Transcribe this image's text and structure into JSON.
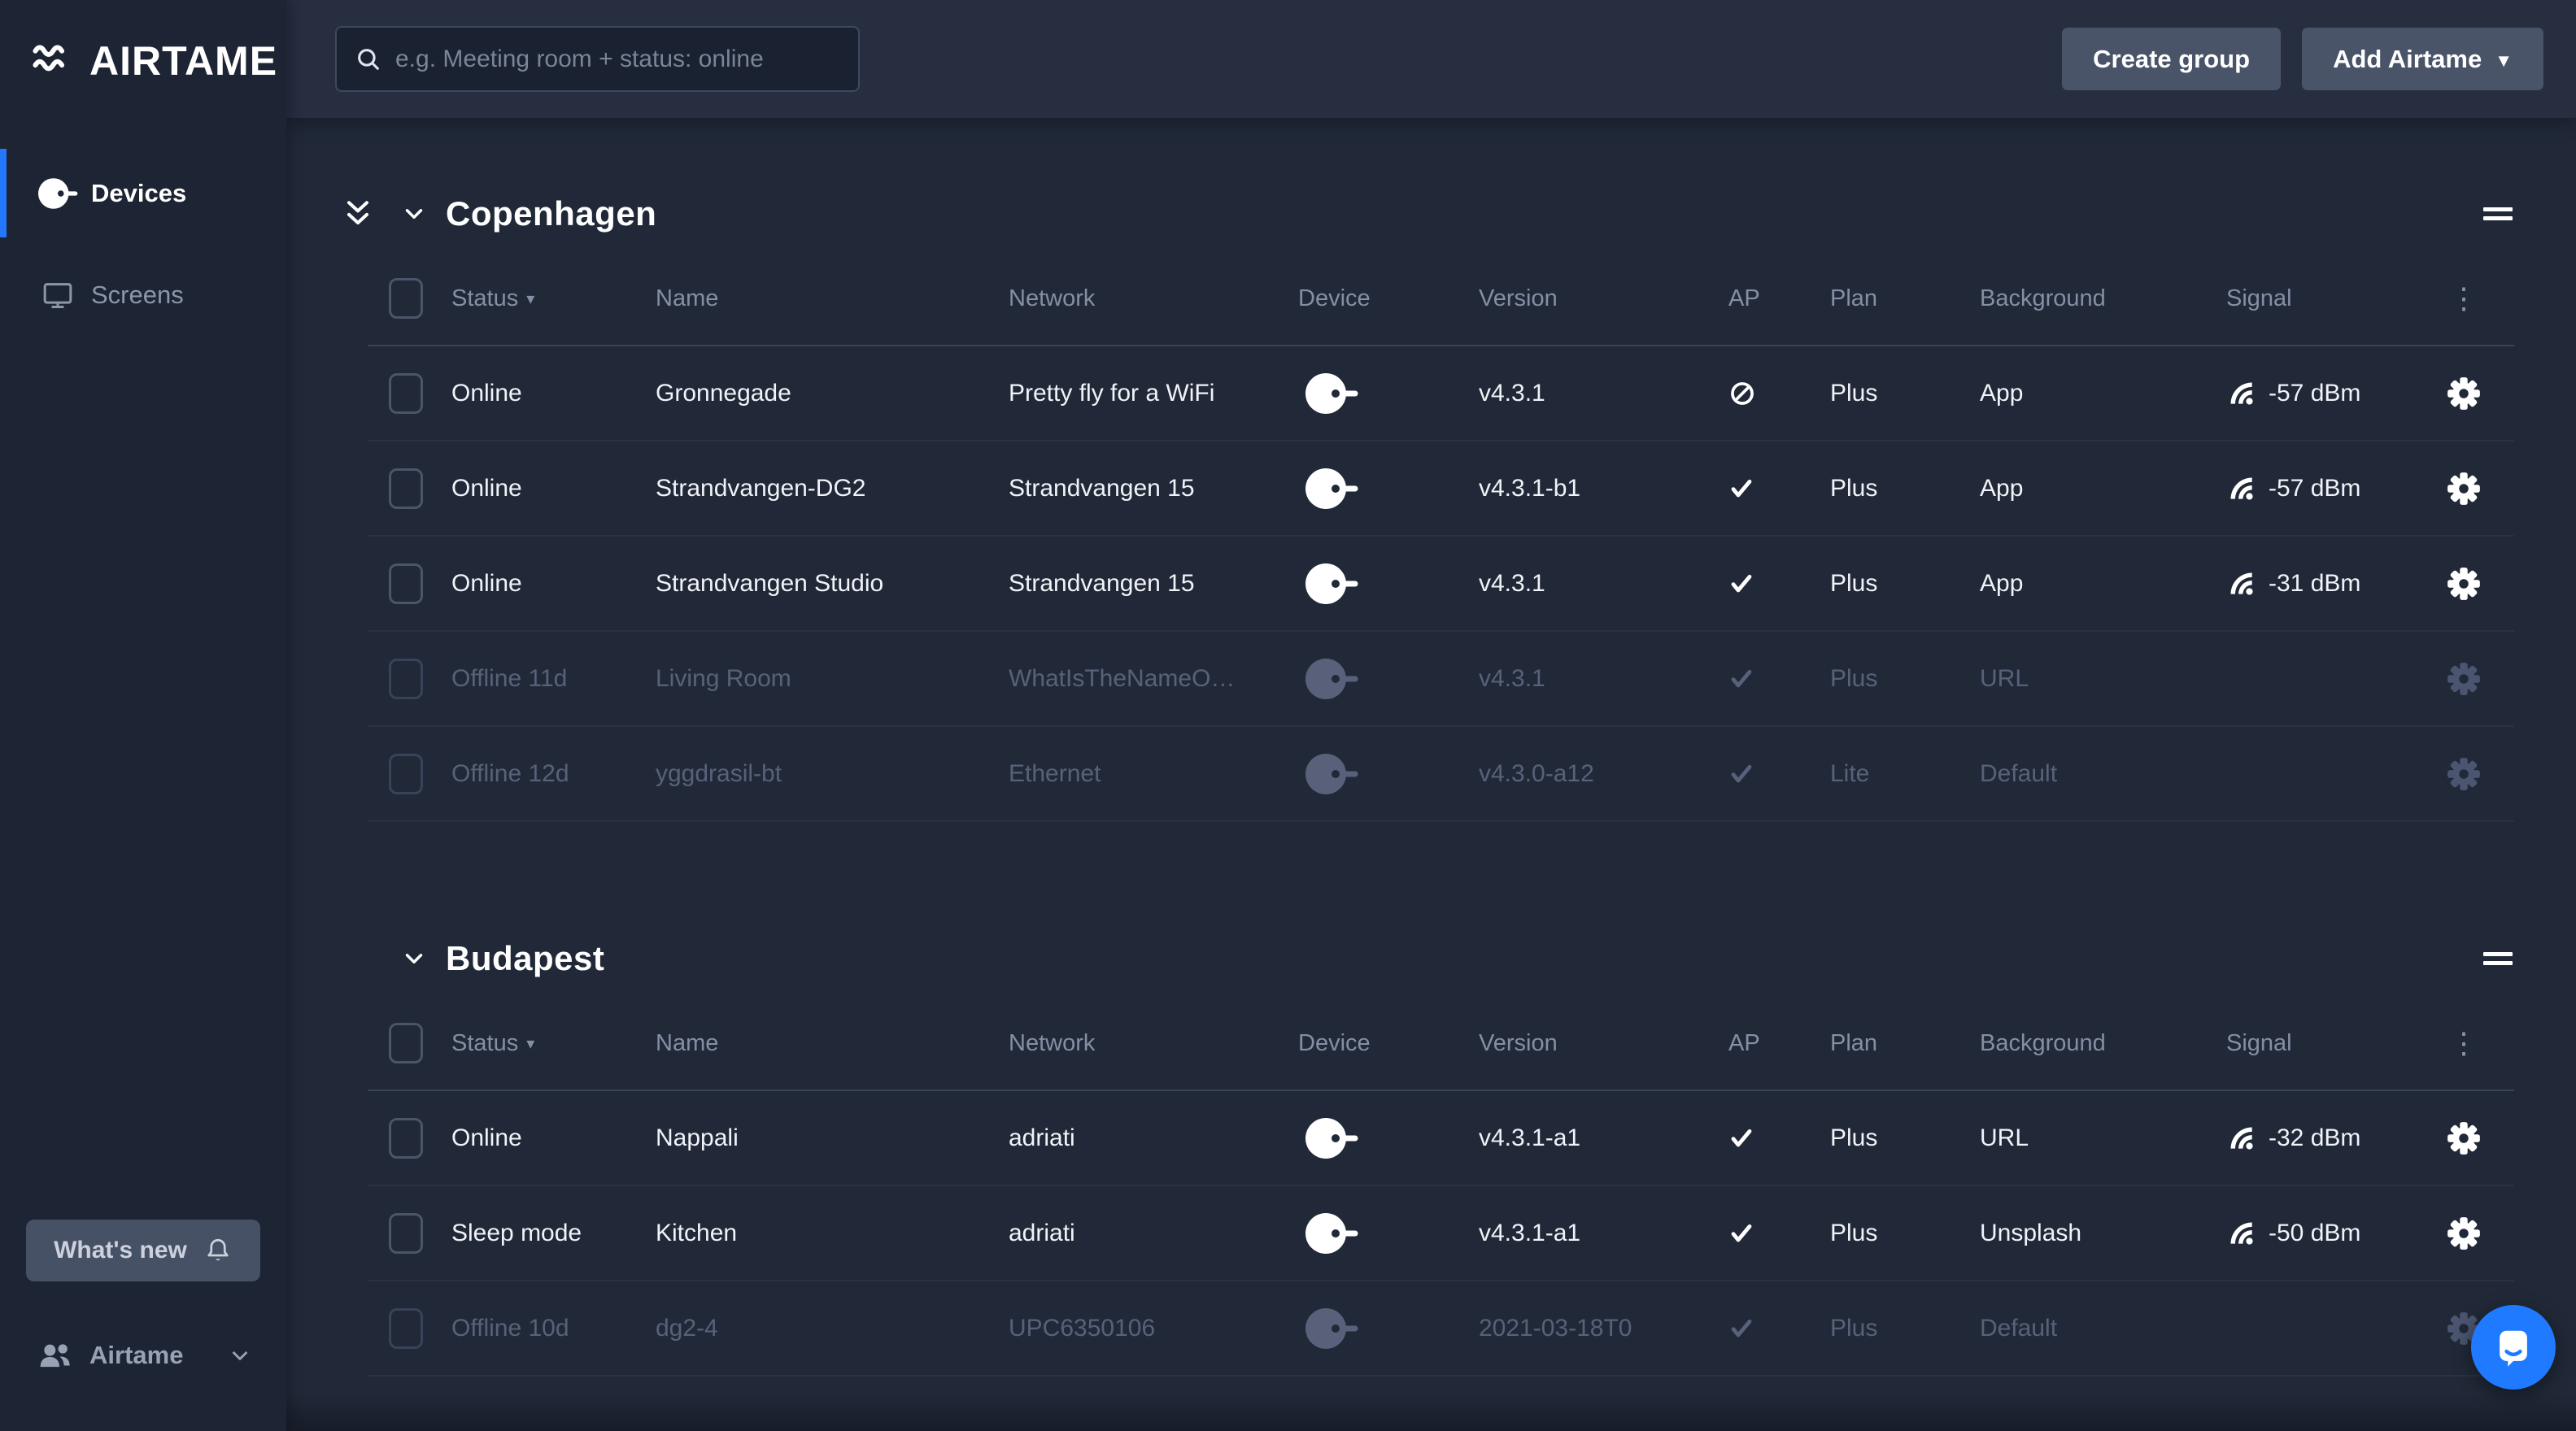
{
  "sidebar": {
    "logo_text": "AIRTAME",
    "nav": [
      {
        "label": "Devices",
        "active": true
      },
      {
        "label": "Screens",
        "active": false
      }
    ],
    "whats_new_label": "What's new",
    "org_label": "Airtame"
  },
  "topbar": {
    "search_placeholder": "e.g. Meeting room + status: online",
    "create_group_label": "Create group",
    "add_airtame_label": "Add Airtame"
  },
  "table": {
    "columns": [
      "Status",
      "Name",
      "Network",
      "Device",
      "Version",
      "AP",
      "Plan",
      "Background",
      "Signal"
    ]
  },
  "groups": [
    {
      "name": "Copenhagen",
      "collapse_all": true,
      "rows": [
        {
          "status": "Online",
          "name": "Gronnegade",
          "network": "Pretty fly for a WiFi",
          "version": "v4.3.1",
          "ap": "blocked",
          "plan": "Plus",
          "background": "App",
          "signal": "-57 dBm",
          "offline": false
        },
        {
          "status": "Online",
          "name": "Strandvangen-DG2",
          "network": "Strandvangen 15",
          "version": "v4.3.1-b1",
          "ap": "check",
          "plan": "Plus",
          "background": "App",
          "signal": "-57 dBm",
          "offline": false
        },
        {
          "status": "Online",
          "name": "Strandvangen Studio",
          "network": "Strandvangen 15",
          "version": "v4.3.1",
          "ap": "check",
          "plan": "Plus",
          "background": "App",
          "signal": "-31 dBm",
          "offline": false
        },
        {
          "status": "Offline 11d",
          "name": "Living Room",
          "network": "WhatIsTheNameO…",
          "version": "v4.3.1",
          "ap": "check",
          "plan": "Plus",
          "background": "URL",
          "signal": "",
          "offline": true
        },
        {
          "status": "Offline 12d",
          "name": "yggdrasil-bt",
          "network": "Ethernet",
          "version": "v4.3.0-a12",
          "ap": "check",
          "plan": "Lite",
          "background": "Default",
          "signal": "",
          "offline": true
        }
      ]
    },
    {
      "name": "Budapest",
      "collapse_all": false,
      "rows": [
        {
          "status": "Online",
          "name": "Nappali",
          "network": "adriati",
          "version": "v4.3.1-a1",
          "ap": "check",
          "plan": "Plus",
          "background": "URL",
          "signal": "-32 dBm",
          "offline": false
        },
        {
          "status": "Sleep mode",
          "name": "Kitchen",
          "network": "adriati",
          "version": "v4.3.1-a1",
          "ap": "check",
          "plan": "Plus",
          "background": "Unsplash",
          "signal": "-50 dBm",
          "offline": false
        },
        {
          "status": "Offline 10d",
          "name": "dg2-4",
          "network": "UPC6350106",
          "version": "2021-03-18T0",
          "ap": "check",
          "plan": "Plus",
          "background": "Default",
          "signal": "",
          "offline": true
        }
      ]
    }
  ],
  "colors": {
    "accent_blue": "#2478ff",
    "intercom_blue": "#1f7aff",
    "sidebar_bg": "#1d2433",
    "topbar_bg": "#262e40",
    "content_bg": "#212938",
    "muted_text": "#858ea4",
    "offline_text": "#59617a"
  }
}
